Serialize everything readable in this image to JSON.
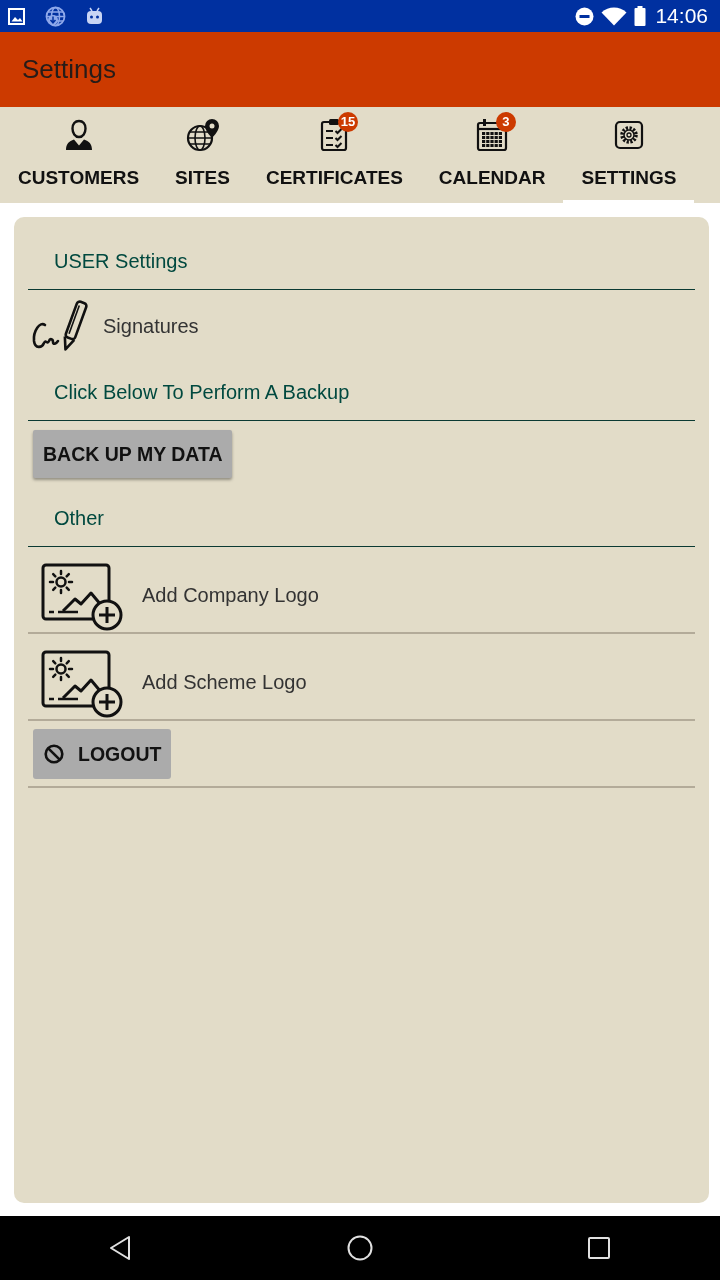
{
  "status_bar": {
    "time": "14:06"
  },
  "app_bar": {
    "title": "Settings"
  },
  "tabs": [
    {
      "label": "CUSTOMERS",
      "selected": false
    },
    {
      "label": "SITES",
      "selected": false
    },
    {
      "label": "CERTIFICATES",
      "selected": false,
      "badge": "15"
    },
    {
      "label": "CALENDAR",
      "selected": false,
      "badge": "3"
    },
    {
      "label": "SETTINGS",
      "selected": true
    }
  ],
  "sections": [
    {
      "header": "USER Settings",
      "items": [
        {
          "kind": "signature",
          "label": "Signatures"
        }
      ]
    },
    {
      "header": "Click Below To Perform A Backup",
      "items": [
        {
          "kind": "raised",
          "label": "BACK UP MY DATA"
        }
      ]
    },
    {
      "header": "Other",
      "items": [
        {
          "kind": "image",
          "label": "Add Company Logo"
        },
        {
          "kind": "image",
          "label": "Add Scheme Logo"
        },
        {
          "kind": "blocked",
          "label": "LOGOUT"
        }
      ]
    }
  ]
}
